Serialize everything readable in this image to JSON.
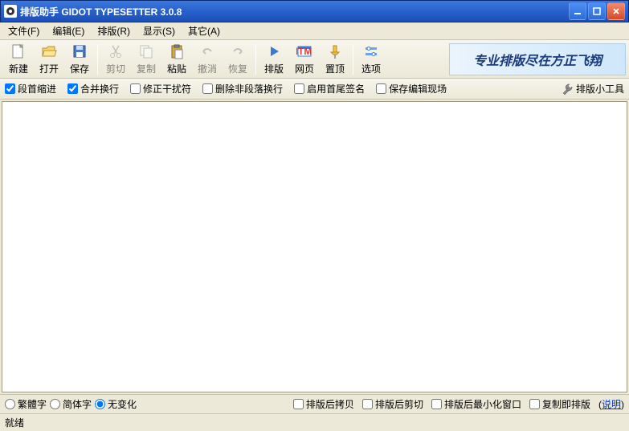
{
  "title": "排版助手 GIDOT TYPESETTER 3.0.8",
  "menus": {
    "file": "文件(F)",
    "edit": "编辑(E)",
    "typeset": "排版(R)",
    "view": "显示(S)",
    "other": "其它(A)"
  },
  "toolbar": {
    "new": "新建",
    "open": "打开",
    "save": "保存",
    "cut": "剪切",
    "copy": "复制",
    "paste": "粘贴",
    "undo": "撤消",
    "redo": "恢复",
    "typeset": "排版",
    "html": "网页",
    "top": "置顶",
    "options": "选项"
  },
  "banner": "专业排版尽在方正飞翔",
  "options": {
    "indent": "段首缩进",
    "merge": "合并换行",
    "fixsym": "修正干扰符",
    "delnonpara": "删除非段落换行",
    "enabsig": "启用首尾签名",
    "savescene": "保存编辑现场",
    "toollink": "排版小工具"
  },
  "radios": {
    "trad": "繁體字",
    "simp": "简体字",
    "none": "无变化"
  },
  "bottom": {
    "copyafter": "排版后拷贝",
    "cutafter": "排版后剪切",
    "minafter": "排版后最小化窗口",
    "copytypeset": "复制即排版",
    "help": "说明"
  },
  "status": "就绪"
}
